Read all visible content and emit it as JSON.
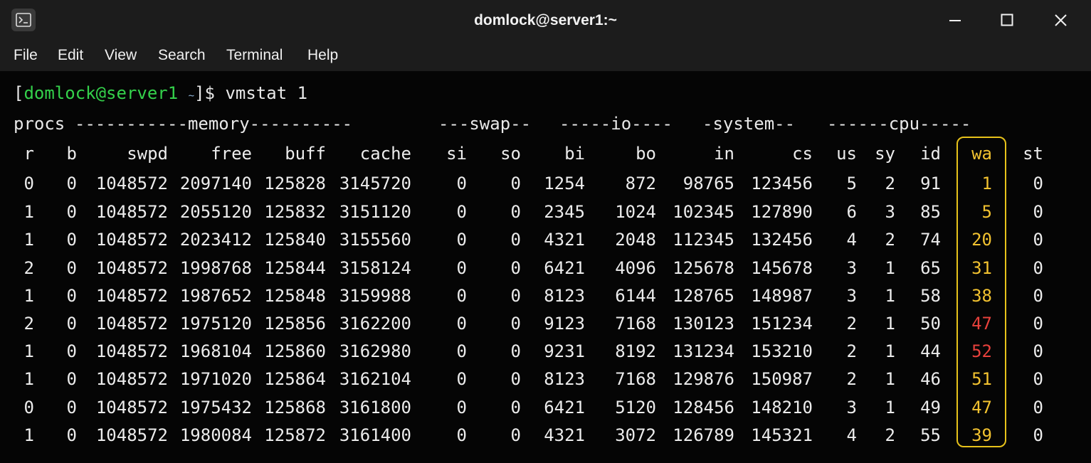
{
  "window": {
    "title": "domlock@server1:~",
    "icons": {
      "app": "terminal-icon",
      "minimize": "minimize-icon",
      "maximize": "maximize-icon",
      "close": "close-icon"
    }
  },
  "menu": {
    "items": [
      {
        "label": "File"
      },
      {
        "label": "Edit"
      },
      {
        "label": "View"
      },
      {
        "label": "Search"
      },
      {
        "label": "Terminal"
      },
      {
        "label": "Help"
      }
    ]
  },
  "prompt": {
    "open": "[",
    "user_host": "domlock@server1",
    "path": "~",
    "close": "]$ ",
    "command": "vmstat 1"
  },
  "vmstat": {
    "group_headers": [
      {
        "key": "procs",
        "text": "procs"
      },
      {
        "key": "memory",
        "text": "-----------memory----------"
      },
      {
        "key": "swap",
        "text": "---swap--"
      },
      {
        "key": "io",
        "text": "-----io----"
      },
      {
        "key": "system",
        "text": "-system--"
      },
      {
        "key": "cpu",
        "text": "------cpu-----"
      }
    ],
    "columns": [
      "r",
      "b",
      "swpd",
      "free",
      "buff",
      "cache",
      "si",
      "so",
      "bi",
      "bo",
      "in",
      "cs",
      "us",
      "sy",
      "id",
      "wa",
      "st"
    ],
    "rows": [
      [
        "0",
        "0",
        "1048572",
        "2097140",
        "125828",
        "3145720",
        "0",
        "0",
        "1254",
        "872",
        "98765",
        "123456",
        "5",
        "2",
        "91",
        "1",
        "0"
      ],
      [
        "1",
        "0",
        "1048572",
        "2055120",
        "125832",
        "3151120",
        "0",
        "0",
        "2345",
        "1024",
        "102345",
        "127890",
        "6",
        "3",
        "85",
        "5",
        "0"
      ],
      [
        "1",
        "0",
        "1048572",
        "2023412",
        "125840",
        "3155560",
        "0",
        "0",
        "4321",
        "2048",
        "112345",
        "132456",
        "4",
        "2",
        "74",
        "20",
        "0"
      ],
      [
        "2",
        "0",
        "1048572",
        "1998768",
        "125844",
        "3158124",
        "0",
        "0",
        "6421",
        "4096",
        "125678",
        "145678",
        "3",
        "1",
        "65",
        "31",
        "0"
      ],
      [
        "1",
        "0",
        "1048572",
        "1987652",
        "125848",
        "3159988",
        "0",
        "0",
        "8123",
        "6144",
        "128765",
        "148987",
        "3",
        "1",
        "58",
        "38",
        "0"
      ],
      [
        "2",
        "0",
        "1048572",
        "1975120",
        "125856",
        "3162200",
        "0",
        "0",
        "9123",
        "7168",
        "130123",
        "151234",
        "2",
        "1",
        "50",
        "47",
        "0"
      ],
      [
        "1",
        "0",
        "1048572",
        "1968104",
        "125860",
        "3162980",
        "0",
        "0",
        "9231",
        "8192",
        "131234",
        "153210",
        "2",
        "1",
        "44",
        "52",
        "0"
      ],
      [
        "1",
        "0",
        "1048572",
        "1971020",
        "125864",
        "3162104",
        "0",
        "0",
        "8123",
        "7168",
        "129876",
        "150987",
        "2",
        "1",
        "46",
        "51",
        "0"
      ],
      [
        "0",
        "0",
        "1048572",
        "1975432",
        "125868",
        "3161800",
        "0",
        "0",
        "6421",
        "5120",
        "128456",
        "148210",
        "3",
        "1",
        "49",
        "47",
        "0"
      ],
      [
        "1",
        "0",
        "1048572",
        "1980084",
        "125872",
        "3161400",
        "0",
        "0",
        "4321",
        "3072",
        "126789",
        "145321",
        "4",
        "2",
        "55",
        "39",
        "0"
      ]
    ],
    "wa_colors": [
      "#f2c230",
      "#f2c230",
      "#f2c230",
      "#f2c230",
      "#f2c230",
      "#e8413c",
      "#e8413c",
      "#f2c230",
      "#f2c230",
      "#f2c230"
    ],
    "highlight_color": "#e7c21a"
  },
  "colors": {
    "prompt_user": "#34d14b",
    "text": "#ececec",
    "titlebar": "#1c1c1c",
    "background": "#050505"
  }
}
